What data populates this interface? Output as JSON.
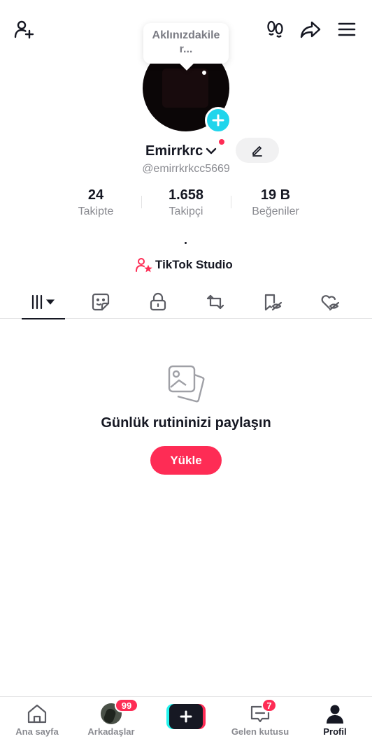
{
  "tooltip": {
    "line1": "Aklınızdakile",
    "line2": "r..."
  },
  "profile": {
    "display_name": "Emirrkrc",
    "username": "@emirrkrkcc5669",
    "bio": "."
  },
  "stats": [
    {
      "value": "24",
      "label": "Takipte"
    },
    {
      "value": "1.658",
      "label": "Takipçi"
    },
    {
      "value": "19 B",
      "label": "Beğeniler"
    }
  ],
  "studio": {
    "label": "TikTok Studio"
  },
  "tabs": [
    {
      "icon": "videos-grid-icon",
      "active": true
    },
    {
      "icon": "sticker-icon",
      "active": false
    },
    {
      "icon": "lock-icon",
      "active": false
    },
    {
      "icon": "repost-icon",
      "active": false
    },
    {
      "icon": "hidden-bookmark-icon",
      "active": false
    },
    {
      "icon": "hidden-heart-icon",
      "active": false
    }
  ],
  "empty_state": {
    "title": "Günlük rutininizi paylaşın",
    "button": "Yükle"
  },
  "bottom_nav": [
    {
      "label": "Ana sayfa",
      "icon": "home-icon"
    },
    {
      "label": "Arkadaşlar",
      "icon": "friends-avatar",
      "badge": "99"
    },
    {
      "label": "",
      "icon": "create-plus-icon"
    },
    {
      "label": "Gelen kutusu",
      "icon": "inbox-icon",
      "badge": "7"
    },
    {
      "label": "Profil",
      "icon": "profile-icon",
      "active": true
    }
  ],
  "colors": {
    "accent": "#fe2c55",
    "cyan": "#20d5ec",
    "text": "#161823",
    "muted": "#8a8b91"
  }
}
